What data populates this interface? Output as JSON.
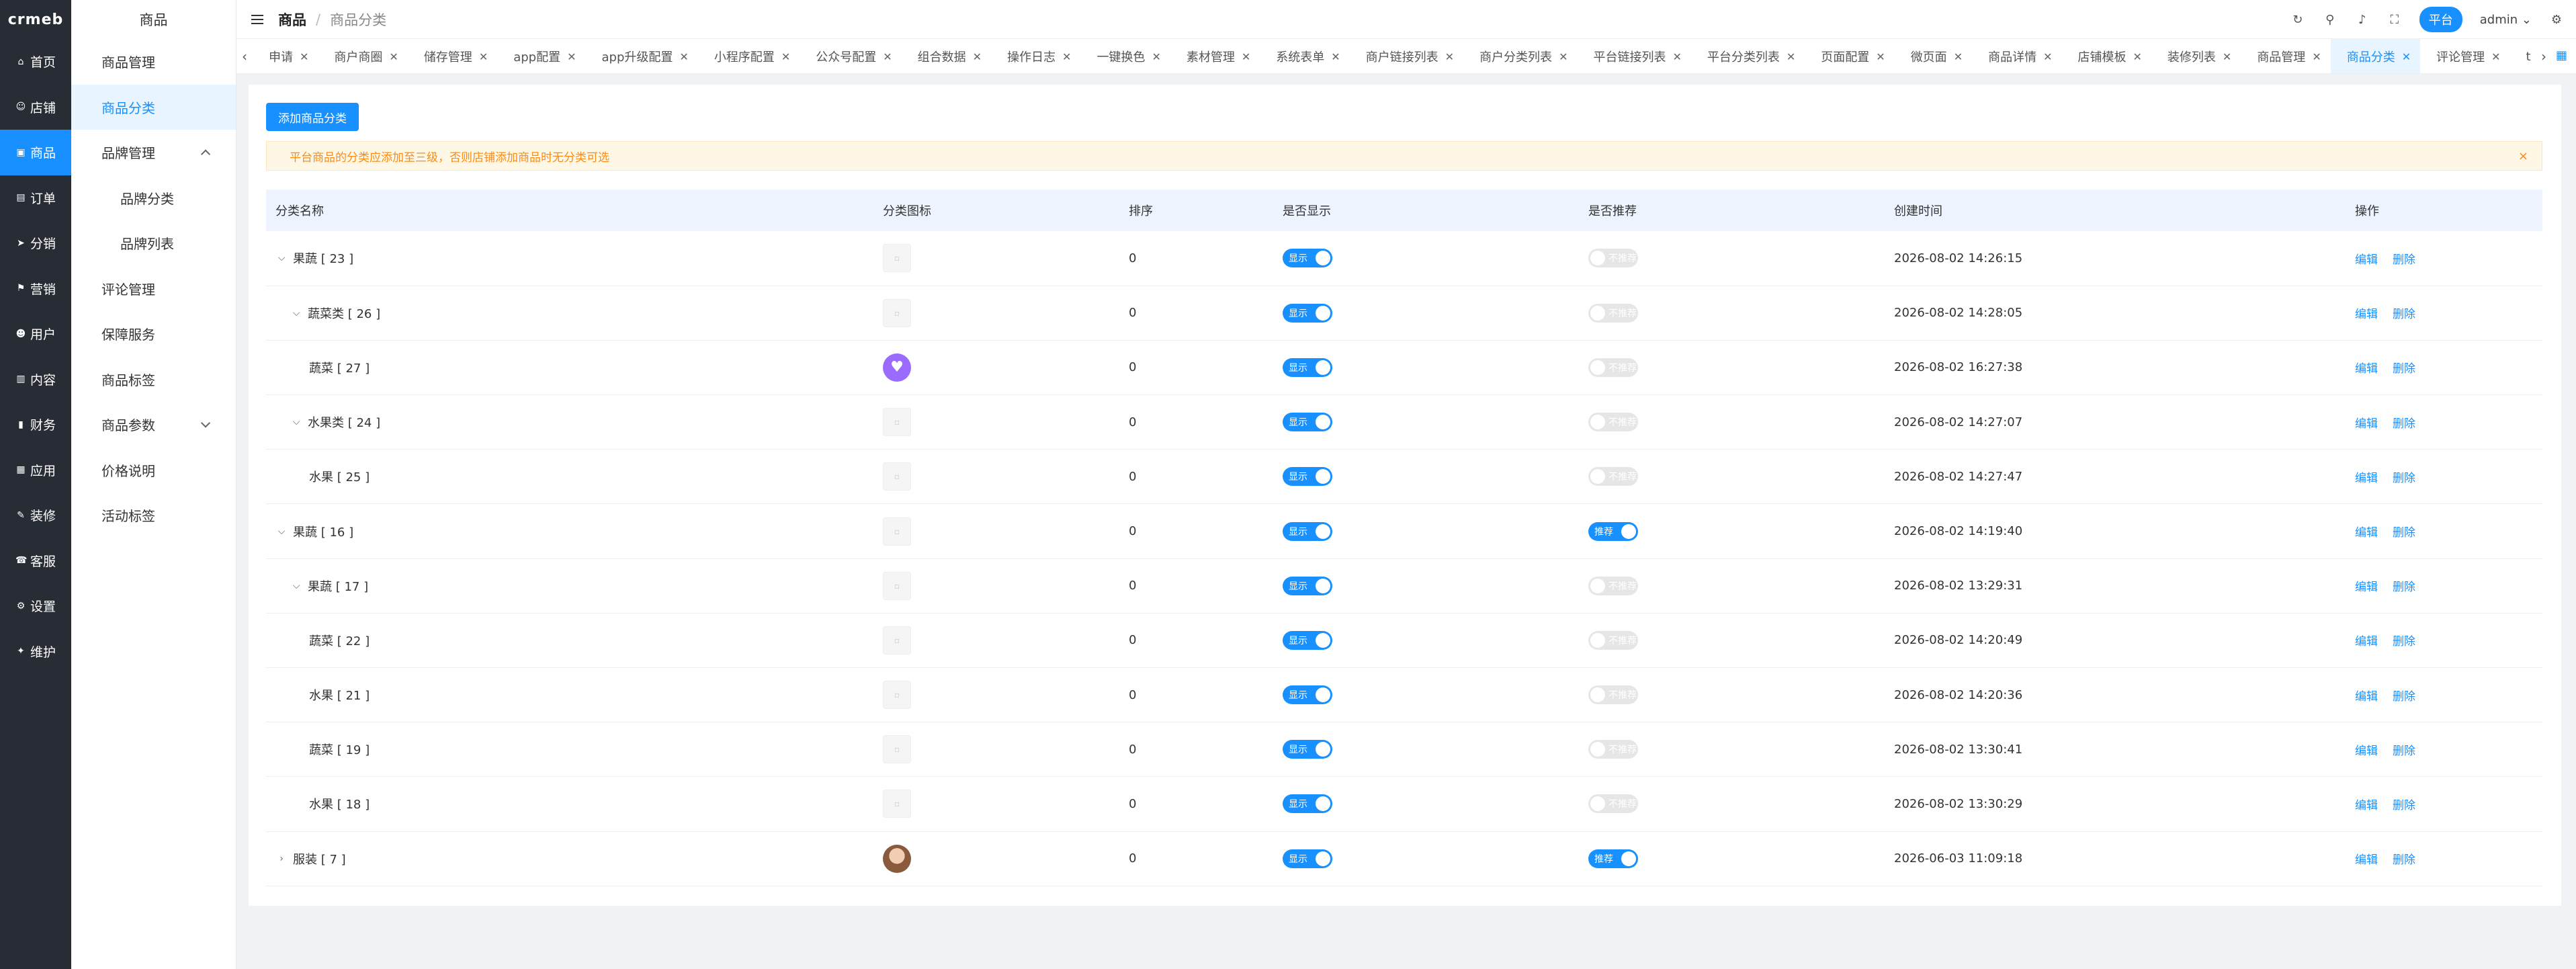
{
  "rail": {
    "logo": "crmeb",
    "items": [
      {
        "label": "首页",
        "icon": "home-icon",
        "glyph": "⌂"
      },
      {
        "label": "店铺",
        "icon": "user-icon",
        "glyph": "☺"
      },
      {
        "label": "商品",
        "icon": "bag-icon",
        "glyph": "▣"
      },
      {
        "label": "订单",
        "icon": "clipboard-icon",
        "glyph": "▤"
      },
      {
        "label": "分销",
        "icon": "send-icon",
        "glyph": "➤"
      },
      {
        "label": "营销",
        "icon": "flag-icon",
        "glyph": "⚑"
      },
      {
        "label": "用户",
        "icon": "person-icon",
        "glyph": "☻"
      },
      {
        "label": "内容",
        "icon": "book-icon",
        "glyph": "▥"
      },
      {
        "label": "财务",
        "icon": "chart-icon",
        "glyph": "▮"
      },
      {
        "label": "应用",
        "icon": "grid-icon",
        "glyph": "▦"
      },
      {
        "label": "装修",
        "icon": "brush-icon",
        "glyph": "✎"
      },
      {
        "label": "客服",
        "icon": "headset-icon",
        "glyph": "☎"
      },
      {
        "label": "设置",
        "icon": "gear-icon",
        "glyph": "⚙"
      },
      {
        "label": "维护",
        "icon": "wrench-icon",
        "glyph": "✦"
      }
    ]
  },
  "side": {
    "title": "商品",
    "items": [
      {
        "label": "商品管理"
      },
      {
        "label": "商品分类"
      },
      {
        "label": "品牌管理"
      },
      {
        "label": "品牌分类"
      },
      {
        "label": "品牌列表"
      },
      {
        "label": "评论管理"
      },
      {
        "label": "保障服务"
      },
      {
        "label": "商品标签"
      },
      {
        "label": "商品参数"
      },
      {
        "label": "价格说明"
      },
      {
        "label": "活动标签"
      }
    ]
  },
  "header": {
    "breadcrumb_root": "商品",
    "breadcrumb_sep": "/",
    "breadcrumb_current": "商品分类",
    "platform": "平台",
    "user": "admin"
  },
  "tabs": [
    "申请",
    "商户商圈",
    "储存管理",
    "app配置",
    "app升级配置",
    "小程序配置",
    "公众号配置",
    "组合数据",
    "操作日志",
    "一键换色",
    "素材管理",
    "系统表单",
    "商户链接列表",
    "商户分类列表",
    "平台链接列表",
    "平台分类列表",
    "页面配置",
    "微页面",
    "商品详情",
    "店铺模板",
    "装修列表",
    "商品管理",
    "商品分类",
    "评论管理",
    "t"
  ],
  "main": {
    "add_button": "添加商品分类",
    "alert": "平台商品的分类应添加至三级，否则店铺添加商品时无分类可选",
    "columns": {
      "name": "分类名称",
      "icon": "分类图标",
      "sort": "排序",
      "show": "是否显示",
      "recommend": "是否推荐",
      "created": "创建时间",
      "ops": "操作"
    },
    "switch_on_show": "显示",
    "switch_off_rec": "不推荐",
    "switch_on_rec": "推荐",
    "edit": "编辑",
    "delete": "删除",
    "rows": [
      {
        "name": "果蔬 [ 23 ]",
        "sort": "0",
        "time": "2026-08-02 14:26:15"
      },
      {
        "name": "蔬菜类 [ 26 ]",
        "sort": "0",
        "time": "2026-08-02 14:28:05"
      },
      {
        "name": "蔬菜 [ 27 ]",
        "sort": "0",
        "time": "2026-08-02 16:27:38"
      },
      {
        "name": "水果类 [ 24 ]",
        "sort": "0",
        "time": "2026-08-02 14:27:07"
      },
      {
        "name": "水果 [ 25 ]",
        "sort": "0",
        "time": "2026-08-02 14:27:47"
      },
      {
        "name": "果蔬 [ 16 ]",
        "sort": "0",
        "time": "2026-08-02 14:19:40"
      },
      {
        "name": "果蔬 [ 17 ]",
        "sort": "0",
        "time": "2026-08-02 13:29:31"
      },
      {
        "name": "蔬菜 [ 22 ]",
        "sort": "0",
        "time": "2026-08-02 14:20:49"
      },
      {
        "name": "水果 [ 21 ]",
        "sort": "0",
        "time": "2026-08-02 14:20:36"
      },
      {
        "name": "蔬菜 [ 19 ]",
        "sort": "0",
        "time": "2026-08-02 13:30:41"
      },
      {
        "name": "水果 [ 18 ]",
        "sort": "0",
        "time": "2026-08-02 13:30:29"
      },
      {
        "name": "服装 [ 7 ]",
        "sort": "0",
        "time": "2026-06-03 11:09:18"
      }
    ]
  }
}
